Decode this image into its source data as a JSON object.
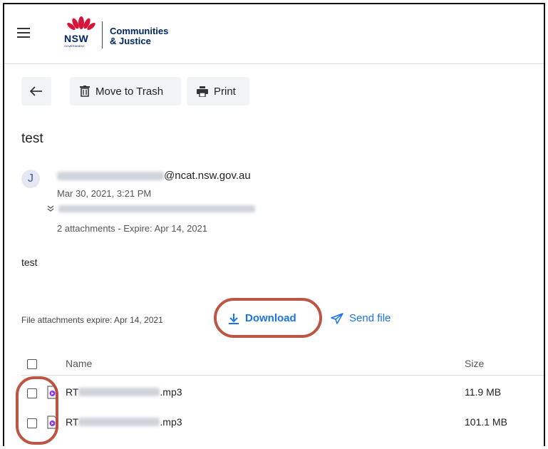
{
  "header": {
    "logo_text": "NSW",
    "logo_sub": "GOVERNMENT",
    "brand_line1": "Communities",
    "brand_line2": "& Justice"
  },
  "toolbar": {
    "trash_label": "Move to Trash",
    "print_label": "Print"
  },
  "message": {
    "subject": "test",
    "avatar_letter": "J",
    "sender_domain": "@ncat.nsw.gov.au",
    "date": "Mar 30, 2021, 3:21 PM",
    "attachments_info": "2 attachments - Expire: Apr 14, 2021",
    "body": "test"
  },
  "attachments": {
    "expire_text": "File attachments expire: Apr 14, 2021",
    "download_label": "Download",
    "send_label": "Send file",
    "columns": {
      "name": "Name",
      "size": "Size"
    },
    "rows": [
      {
        "prefix": "RT",
        "ext": ".mp3",
        "size": "11.9 MB"
      },
      {
        "prefix": "RT",
        "ext": ".mp3",
        "size": "101.1 MB"
      }
    ]
  },
  "colors": {
    "accent": "#1a73e8",
    "annotation": "#b5432f",
    "brand": "#002664",
    "waratah": "#d7153a"
  }
}
